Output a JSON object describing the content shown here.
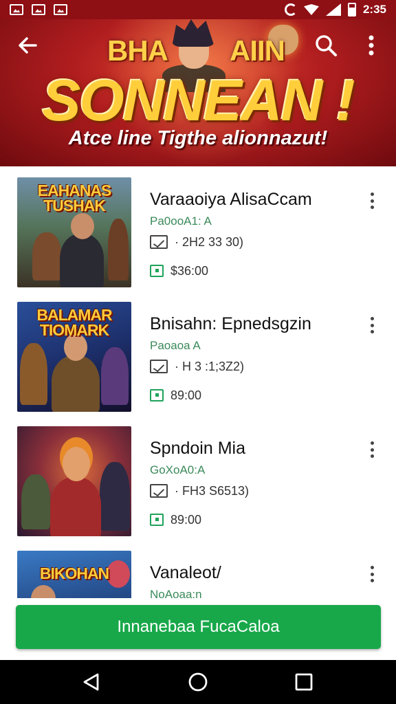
{
  "status_bar": {
    "time": "2:35",
    "notification_icons": [
      "image-icon",
      "gallery-icon",
      "flag-icon"
    ]
  },
  "header": {
    "top_text_left": "BHA",
    "top_text_right": "AIIN",
    "title": "SONNEAN !",
    "subtitle": "Atce line Tigthe alionnazut!"
  },
  "games": [
    {
      "title": "Varaaoiya AlisaCcam",
      "genre": "Pa0ooA1: A",
      "date": "· 2H2 33 30)",
      "price": "$36:00",
      "cover_logo": "EAHANAS TUSHAK"
    },
    {
      "title": "Bnisahn: Epnedsgzin",
      "genre": "Paoaoa A",
      "date": "· H 3 :1;3Z2)",
      "price": "89:00",
      "cover_logo": "BALAMAR TIOMARK"
    },
    {
      "title": "Spndoin Mia",
      "genre": "GoXoA0:A",
      "date": "· FH3 S6513)",
      "price": "89:00",
      "cover_logo": ""
    },
    {
      "title": "Vanaleot/",
      "genre": "NoAoaa:n",
      "date": "",
      "price": "",
      "cover_logo": "BIKOHAN"
    }
  ],
  "cta": {
    "label": "Innanebaa FucaCaloa"
  },
  "colors": {
    "status_bar": "#8e0f14",
    "banner": "#b01d1f",
    "title_gold": "#ffce3a",
    "accent_green": "#18a84a",
    "genre_green": "#3a8a5a",
    "nav_bar": "#000000"
  }
}
